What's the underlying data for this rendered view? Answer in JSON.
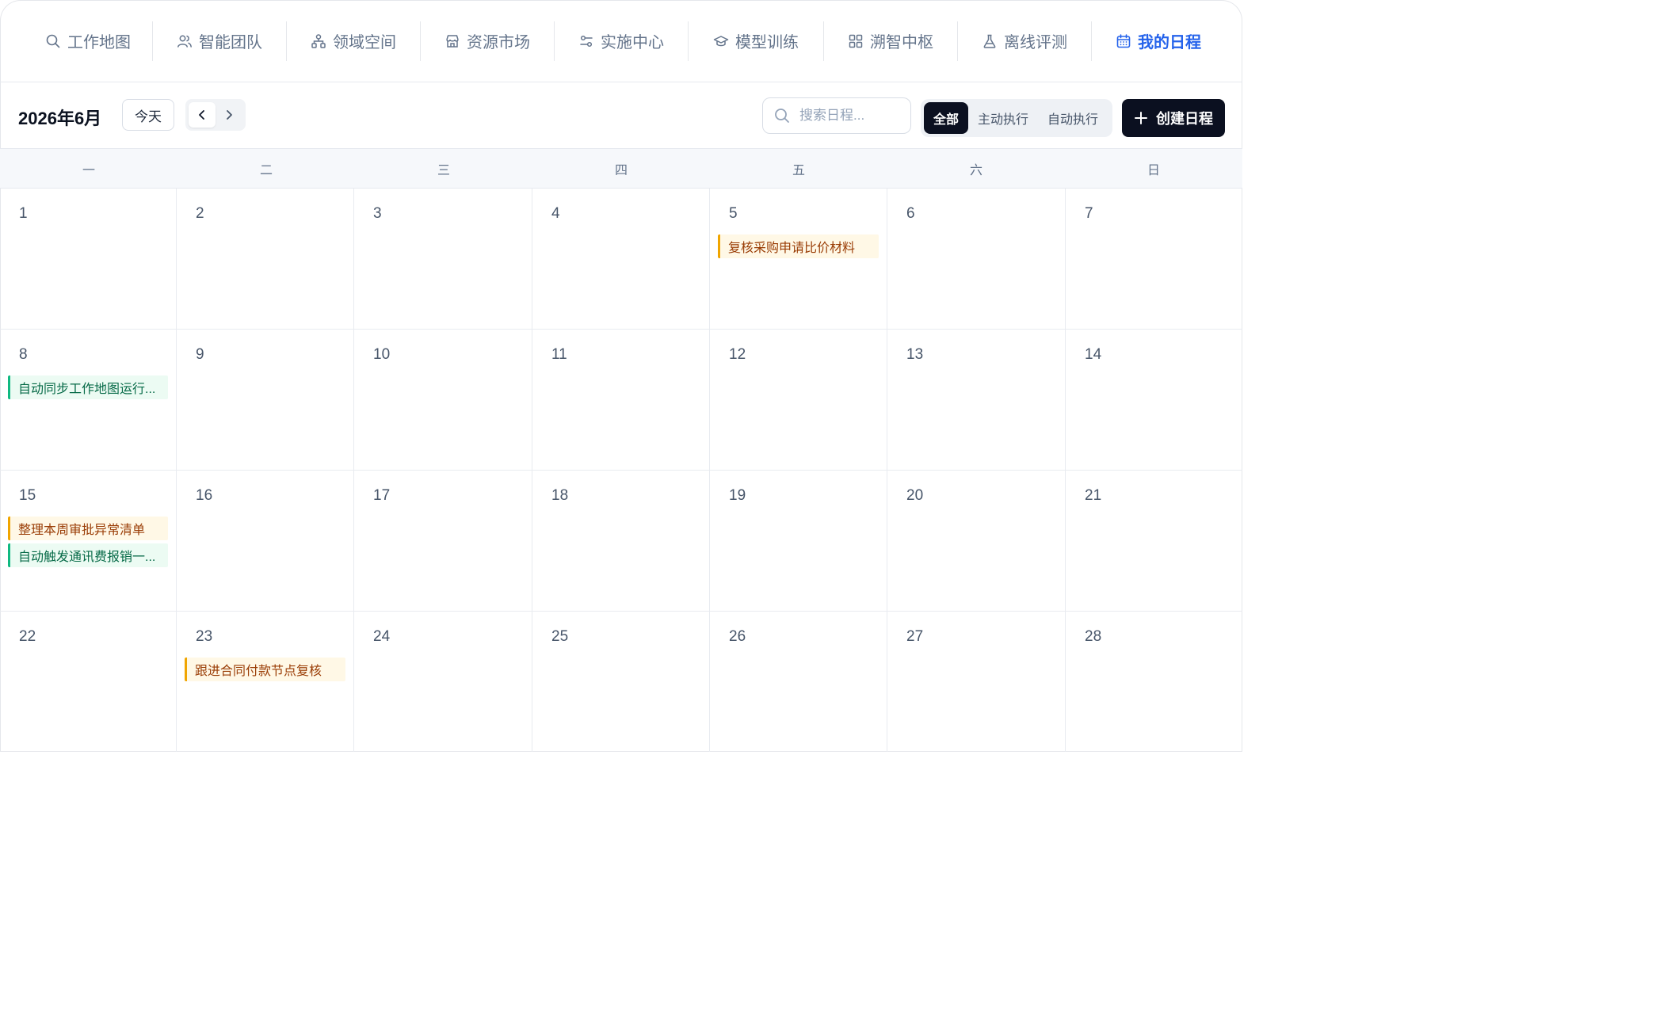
{
  "nav": {
    "items": [
      {
        "label": "工作地图",
        "icon": "search-icon"
      },
      {
        "label": "智能团队",
        "icon": "users-icon"
      },
      {
        "label": "领域空间",
        "icon": "hierarchy-icon"
      },
      {
        "label": "资源市场",
        "icon": "store-icon"
      },
      {
        "label": "实施中心",
        "icon": "sliders-icon"
      },
      {
        "label": "模型训练",
        "icon": "graduation-cap-icon"
      },
      {
        "label": "溯智中枢",
        "icon": "grid-icon"
      },
      {
        "label": "离线评测",
        "icon": "flask-icon"
      },
      {
        "label": "我的日程",
        "icon": "calendar-icon",
        "active": true
      }
    ]
  },
  "toolbar": {
    "month_title": "2026年6月",
    "today_label": "今天",
    "search_placeholder": "搜索日程...",
    "filters": [
      "全部",
      "主动执行",
      "自动执行"
    ],
    "create_label": "创建日程"
  },
  "weekdays": [
    "一",
    "二",
    "三",
    "四",
    "五",
    "六",
    "日"
  ],
  "days": [
    {
      "num": "1",
      "events": []
    },
    {
      "num": "2",
      "events": []
    },
    {
      "num": "3",
      "events": []
    },
    {
      "num": "4",
      "events": []
    },
    {
      "num": "5",
      "events": [
        {
          "title": "复核采购申请比价材料",
          "kind": "manual"
        }
      ]
    },
    {
      "num": "6",
      "events": []
    },
    {
      "num": "7",
      "events": []
    },
    {
      "num": "8",
      "events": [
        {
          "title": "自动同步工作地图运行...",
          "kind": "auto"
        }
      ]
    },
    {
      "num": "9",
      "events": []
    },
    {
      "num": "10",
      "events": []
    },
    {
      "num": "11",
      "events": []
    },
    {
      "num": "12",
      "events": []
    },
    {
      "num": "13",
      "events": []
    },
    {
      "num": "14",
      "events": []
    },
    {
      "num": "15",
      "events": [
        {
          "title": "整理本周审批异常清单",
          "kind": "manual"
        },
        {
          "title": "自动触发通讯费报销一...",
          "kind": "auto"
        }
      ]
    },
    {
      "num": "16",
      "events": []
    },
    {
      "num": "17",
      "events": []
    },
    {
      "num": "18",
      "events": []
    },
    {
      "num": "19",
      "events": []
    },
    {
      "num": "20",
      "events": []
    },
    {
      "num": "21",
      "events": []
    },
    {
      "num": "22",
      "events": []
    },
    {
      "num": "23",
      "events": [
        {
          "title": "跟进合同付款节点复核",
          "kind": "manual"
        }
      ]
    },
    {
      "num": "24",
      "events": []
    },
    {
      "num": "25",
      "events": []
    },
    {
      "num": "26",
      "events": []
    },
    {
      "num": "27",
      "events": []
    },
    {
      "num": "28",
      "events": []
    }
  ],
  "colors": {
    "accent": "#2563eb",
    "dark": "#0b1020",
    "manual": "#f0a500",
    "auto": "#10b981"
  }
}
